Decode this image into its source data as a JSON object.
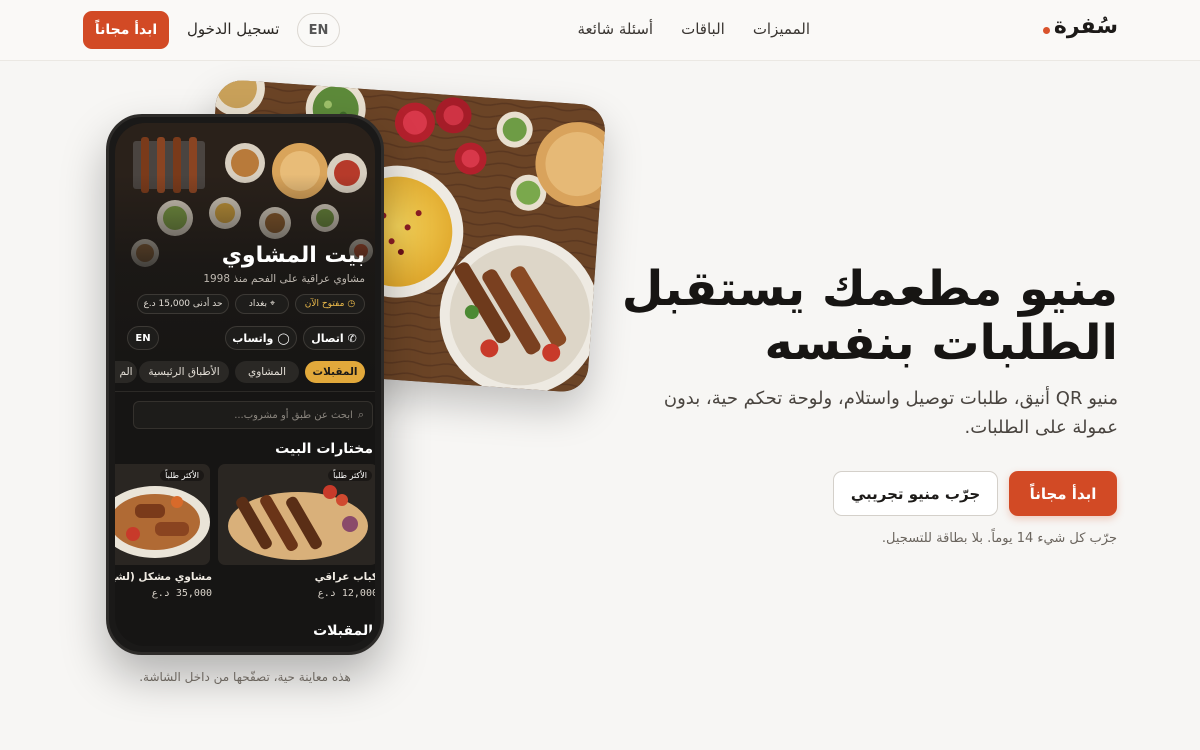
{
  "nav": {
    "logo": "سُفرة",
    "links": [
      "المميزات",
      "الباقات",
      "أسئلة شائعة"
    ],
    "lang": "EN",
    "login": "تسجيل الدخول",
    "cta": "ابدأ مجاناً"
  },
  "hero": {
    "title_line1": "منيو مطعمك يستقبل",
    "title_line2": "الطلبات بنفسه",
    "subtitle": "منيو QR أنيق، طلبات توصيل واستلام، ولوحة تحكم حية، بدون عمولة على الطلبات.",
    "cta_primary": "ابدأ مجاناً",
    "cta_secondary": "جرّب منيو تجريبي",
    "note": "جرّب كل شيء 14 يوماً. بلا بطاقة للتسجيل."
  },
  "phone": {
    "restaurant_name": "بيت المشاوي",
    "tagline": "مشاوي عراقية على الفحم منذ 1998",
    "chips": {
      "open": "مفتوح الآن",
      "city": "بغداد",
      "min_order": "حد أدنى 15,000 د.ع"
    },
    "call": "اتصال",
    "whatsapp": "واتساب",
    "lang": "EN",
    "categories": [
      "المقبلات",
      "المشاوي",
      "الأطباق الرئيسية",
      "الم"
    ],
    "search_placeholder": "ابحث عن طبق أو مشروب...",
    "section_featured": "مختارات البيت",
    "dishes": [
      {
        "badge": "الأكثر طلباً",
        "name": "كباب عراقي",
        "price": "12,000 د.ع"
      },
      {
        "badge": "الأكثر طلباً",
        "name": "مشاوي مشكل (لشخ",
        "price": "35,000 د.ع"
      }
    ],
    "section_next": "المقبلات"
  },
  "caption": "هذه معاينة حية، تصفّحها من داخل الشاشة.",
  "colors": {
    "accent": "#d24a25",
    "category_active": "#e2a93b",
    "open_status": "#e8b84a"
  }
}
